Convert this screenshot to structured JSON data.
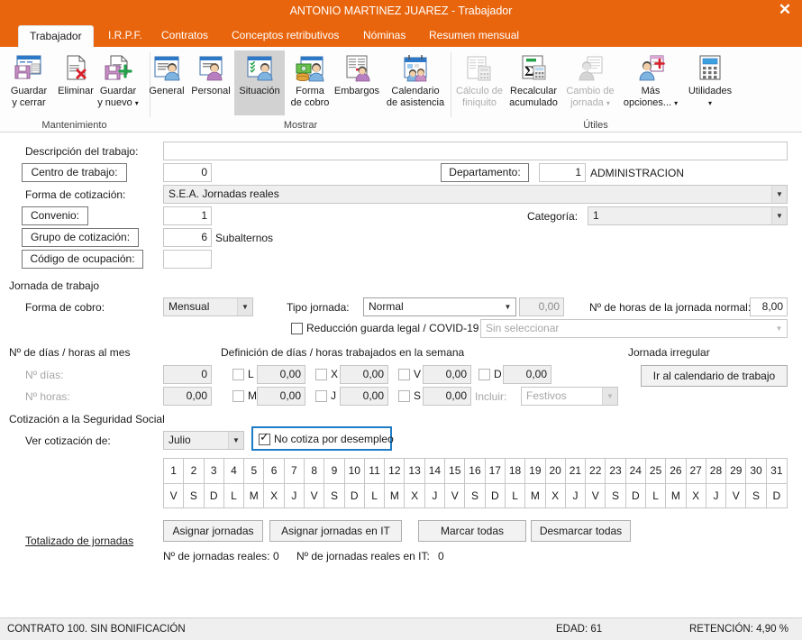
{
  "window": {
    "title": "ANTONIO MARTINEZ JUAREZ - Trabajador",
    "close_label": "✕",
    "accent_color": "#E8650D"
  },
  "tabs": [
    {
      "label": "Trabajador",
      "active": true
    },
    {
      "label": "I.R.P.F.",
      "active": false
    },
    {
      "label": "Contratos",
      "active": false
    },
    {
      "label": "Conceptos retributivos",
      "active": false
    },
    {
      "label": "Nóminas",
      "active": false
    },
    {
      "label": "Resumen mensual",
      "active": false
    }
  ],
  "ribbon": {
    "groups": [
      {
        "label": "Mantenimiento"
      },
      {
        "label": "Mostrar"
      },
      {
        "label": "Útiles"
      }
    ],
    "buttons": [
      {
        "line1": "Guardar",
        "line2": "y cerrar",
        "icon": "save-close-icon"
      },
      {
        "line1": "Eliminar",
        "line2": "",
        "icon": "delete-document-icon"
      },
      {
        "line1": "Guardar",
        "line2": "y nuevo",
        "icon": "save-new-icon",
        "caret": true
      },
      {
        "line1": "General",
        "line2": "",
        "icon": "general-person-icon"
      },
      {
        "line1": "Personal",
        "line2": "",
        "icon": "personal-person-icon"
      },
      {
        "line1": "Situación",
        "line2": "",
        "icon": "situacion-person-icon",
        "selected": true
      },
      {
        "line1": "Forma",
        "line2": "de cobro",
        "icon": "money-person-icon"
      },
      {
        "line1": "Embargos",
        "line2": "",
        "icon": "embargos-person-icon"
      },
      {
        "line1": "Calendario",
        "line2": "de asistencia",
        "icon": "calendar-people-icon"
      },
      {
        "line1": "Cálculo de",
        "line2": "finiquito",
        "icon": "finiquito-calc-icon",
        "disabled": true
      },
      {
        "line1": "Recalcular",
        "line2": "acumulado",
        "icon": "sigma-calc-icon"
      },
      {
        "line1": "Cambio de",
        "line2": "jornada",
        "icon": "cambio-jornada-icon",
        "disabled": true,
        "caret": true
      },
      {
        "line1": "Más",
        "line2": "opciones...",
        "icon": "mas-opciones-icon",
        "caret": true
      },
      {
        "line1": "Utilidades",
        "line2": "",
        "icon": "calculator-icon",
        "caret": true
      }
    ]
  },
  "form": {
    "descripcion_label": "Descripción del trabajo:",
    "descripcion_value": "",
    "centro_label": "Centro de trabajo:",
    "centro_value": "0",
    "departamento_label": "Departamento:",
    "departamento_value": "1",
    "departamento_name": "ADMINISTRACION",
    "forma_cotizacion_label": "Forma de cotización:",
    "forma_cotizacion_value": "S.E.A. Jornadas reales",
    "convenio_label": "Convenio:",
    "convenio_value": "1",
    "categoria_label": "Categoría:",
    "categoria_value": "1",
    "grupo_label": "Grupo de cotización:",
    "grupo_value": "6",
    "grupo_name": "Subalternos",
    "codigo_ocupacion_label": "Código de ocupación:",
    "codigo_ocupacion_value": ""
  },
  "jornada": {
    "section_label": "Jornada de trabajo",
    "forma_cobro_label": "Forma de cobro:",
    "forma_cobro_value": "Mensual",
    "tipo_jornada_label": "Tipo jornada:",
    "tipo_jornada_value": "Normal",
    "tipo_jornada_num": "0,00",
    "horas_normal_label": "Nº de horas de la jornada normal:",
    "horas_normal_value": "8,00",
    "reduccion_label": "Reducción guarda legal / COVID-19",
    "reduccion_checked": false,
    "reduccion_select_value": "Sin seleccionar"
  },
  "dias_mes": {
    "section_label": "Nº de días / horas al mes",
    "dias_label": "Nº días:",
    "dias_value": "0",
    "horas_label": "Nº horas:",
    "horas_value": "0,00"
  },
  "semana": {
    "section_label": "Definición de días / horas trabajados en la semana",
    "days": [
      {
        "code": "L",
        "value": "0,00",
        "checked": false
      },
      {
        "code": "M",
        "value": "0,00",
        "checked": false
      },
      {
        "code": "X",
        "value": "0,00",
        "checked": false
      },
      {
        "code": "J",
        "value": "0,00",
        "checked": false
      },
      {
        "code": "V",
        "value": "0,00",
        "checked": false
      },
      {
        "code": "S",
        "value": "0,00",
        "checked": false
      },
      {
        "code": "D",
        "value": "0,00",
        "checked": false
      }
    ],
    "incluir_label": "Incluir:",
    "incluir_value": "Festivos"
  },
  "irregular": {
    "section_label": "Jornada irregular",
    "button_label": "Ir al calendario de trabajo"
  },
  "cotizacion": {
    "section_label": "Cotización a la Seguridad Social",
    "ver_label": "Ver cotización de:",
    "mes_value": "Julio",
    "no_cotiza_label": "No cotiza por desempleo",
    "no_cotiza_checked": true,
    "focus_color": "#1E7BC4",
    "day_numbers": [
      "1",
      "2",
      "3",
      "4",
      "5",
      "6",
      "7",
      "8",
      "9",
      "10",
      "11",
      "12",
      "13",
      "14",
      "15",
      "16",
      "17",
      "18",
      "19",
      "20",
      "21",
      "22",
      "23",
      "24",
      "25",
      "26",
      "27",
      "28",
      "29",
      "30",
      "31"
    ],
    "day_letters": [
      "V",
      "S",
      "D",
      "L",
      "M",
      "X",
      "J",
      "V",
      "S",
      "D",
      "L",
      "M",
      "X",
      "J",
      "V",
      "S",
      "D",
      "L",
      "M",
      "X",
      "J",
      "V",
      "S",
      "D",
      "L",
      "M",
      "X",
      "J",
      "V",
      "S",
      "D"
    ]
  },
  "totalizado": {
    "link_label": "Totalizado de jornadas",
    "buttons": [
      {
        "label": "Asignar jornadas"
      },
      {
        "label": "Asignar jornadas en IT"
      },
      {
        "label": "Marcar todas"
      },
      {
        "label": "Desmarcar todas"
      }
    ],
    "reales_label": "Nº de jornadas reales:",
    "reales_value": "0",
    "reales_it_label": "Nº de jornadas reales en IT:",
    "reales_it_value": "0"
  },
  "statusbar": {
    "contrato": "CONTRATO 100.  SIN BONIFICACIÓN",
    "edad": "EDAD: 61",
    "retencion": "RETENCIÓN: 4,90 %"
  }
}
